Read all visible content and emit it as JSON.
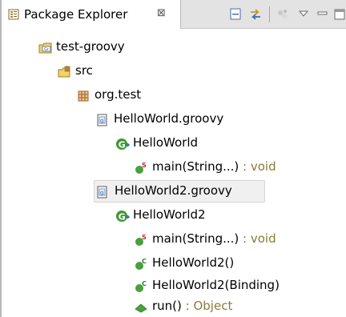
{
  "view": {
    "tab_title": "Package Explorer",
    "tab_close_glyph": "⊠",
    "icons": {
      "tab": "package-explorer-icon",
      "collapse": "collapse-all-icon",
      "link": "link-with-editor-icon",
      "filter": "focus-icon",
      "menu": "view-menu-icon",
      "minimize": "minimize-icon",
      "maximize": "maximize-icon"
    }
  },
  "tree": {
    "project": {
      "label": "test-groovy",
      "icon": "groovy-project-icon"
    },
    "src": {
      "label": "src",
      "icon": "source-folder-icon"
    },
    "package": {
      "label": "org.test",
      "icon": "package-icon"
    },
    "file1": {
      "label": "HelloWorld.groovy",
      "icon": "groovy-file-icon"
    },
    "class1": {
      "label": "HelloWorld",
      "icon": "class-icon"
    },
    "c1_main": {
      "label": "main(String...)",
      "type": " : void",
      "icon": "static-method-icon"
    },
    "file2": {
      "label": "HelloWorld2.groovy",
      "icon": "groovy-file-icon"
    },
    "class2": {
      "label": "HelloWorld2",
      "icon": "class-icon"
    },
    "c2_main": {
      "label": "main(String...)",
      "type": " : void",
      "icon": "static-method-icon"
    },
    "c2_ctor1": {
      "label": "HelloWorld2()",
      "icon": "constructor-icon"
    },
    "c2_ctor2": {
      "label": "HelloWorld2(Binding)",
      "icon": "constructor-icon"
    },
    "c2_run": {
      "label": "run()",
      "type": " : Object",
      "icon": "method-icon"
    }
  },
  "colors": {
    "class_green": "#3c9a2f",
    "method_green": "#49a03c",
    "static_red": "#c8282a",
    "type_olive": "#8a7a3d",
    "package_brown": "#a0612c"
  }
}
